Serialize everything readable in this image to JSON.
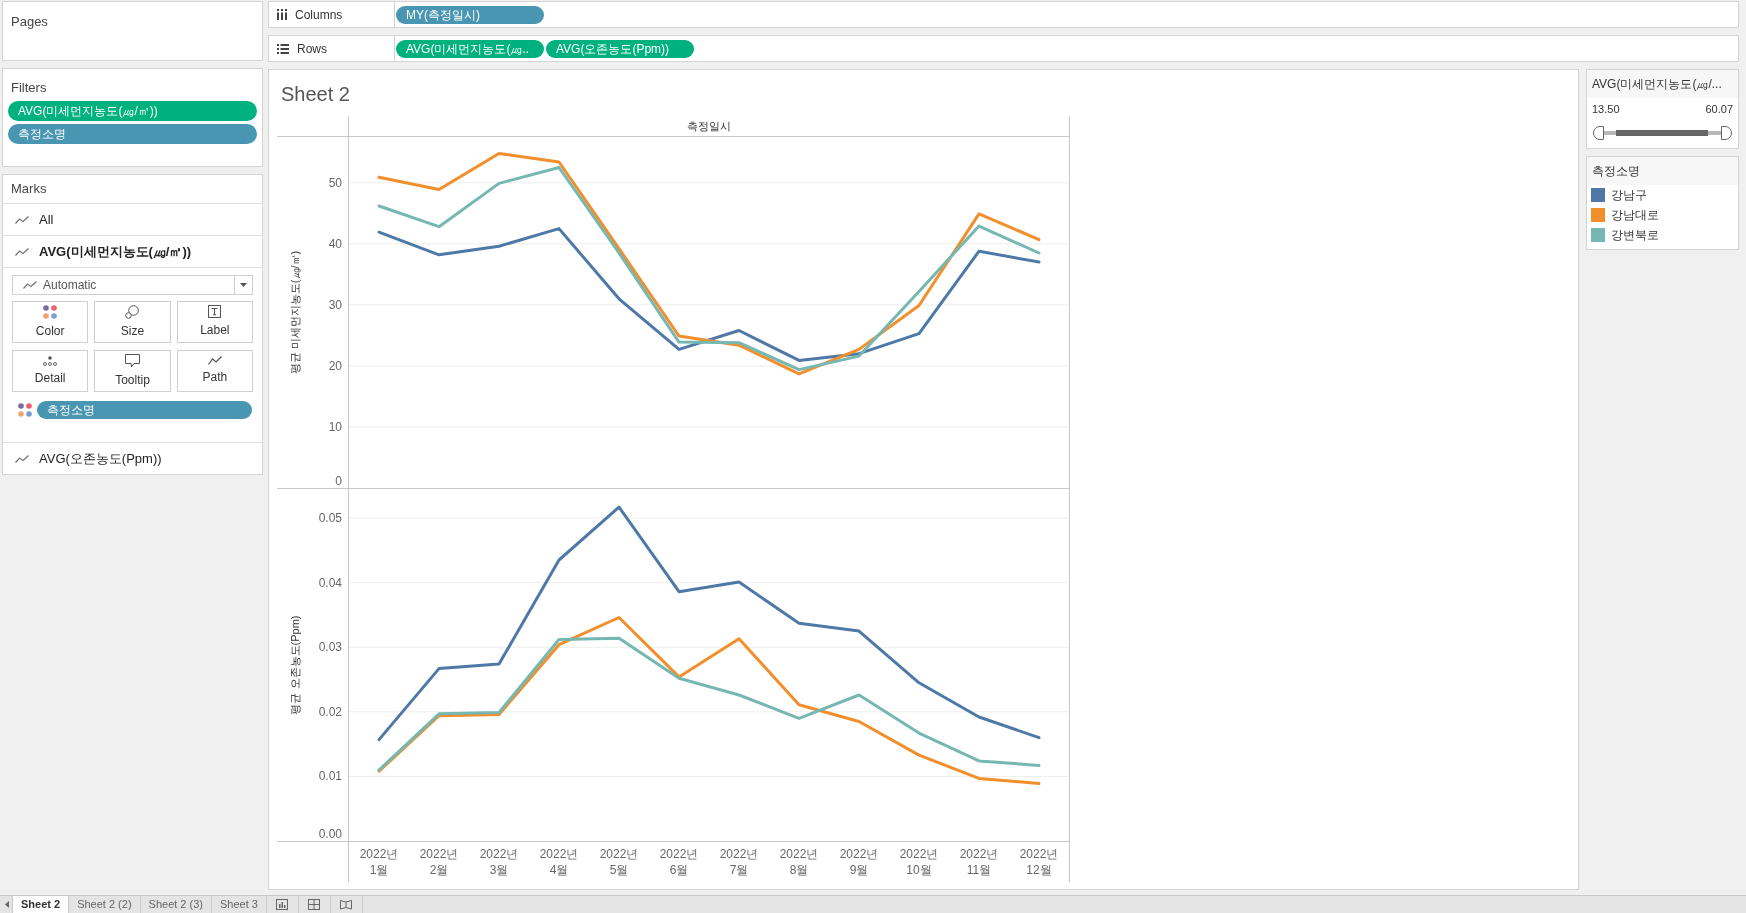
{
  "pages": {
    "title": "Pages"
  },
  "filters": {
    "title": "Filters",
    "pills": [
      {
        "label": "AVG(미세먼지농도(㎍/㎥))",
        "kind": "measure"
      },
      {
        "label": "측정소명",
        "kind": "dimension"
      }
    ]
  },
  "marks": {
    "title": "Marks",
    "cards": [
      {
        "label": "All",
        "expanded": false
      },
      {
        "label": "AVG(미세먼지농도(㎍/㎥))",
        "expanded": true,
        "mark_type": "Automatic",
        "properties": [
          "Color",
          "Size",
          "Label",
          "Detail",
          "Tooltip",
          "Path"
        ],
        "pills": [
          {
            "label": "측정소명",
            "kind": "dimension"
          }
        ]
      },
      {
        "label": "AVG(오존농도(Ppm))",
        "expanded": false
      }
    ]
  },
  "shelves": [
    {
      "label": "Columns",
      "kind": "columns",
      "pills": [
        {
          "label": "MY(측정일시)",
          "kind": "dimension"
        }
      ]
    },
    {
      "label": "Rows",
      "kind": "rows",
      "pills": [
        {
          "label": "AVG(미세먼지농도(㎍..",
          "kind": "measure"
        },
        {
          "label": "AVG(오존농도(Ppm))",
          "kind": "measure"
        }
      ]
    }
  ],
  "sheet": {
    "title": "Sheet 2",
    "column_header": "측정일시",
    "chart_data": [
      {
        "type": "line",
        "ylabel": "평균 미세먼지농도(㎍/㎥)",
        "series": [
          {
            "color": "#4e79a7",
            "values": [
              41.9,
              38.2,
              39.6,
              42.5,
              31.0,
              22.7,
              25.8,
              20.9,
              22.0,
              25.3,
              38.8,
              37.0
            ]
          },
          {
            "color": "#f28e2b",
            "values": [
              50.9,
              48.9,
              54.8,
              53.4,
              39.2,
              24.9,
              23.4,
              18.7,
              22.7,
              29.9,
              44.9,
              40.7
            ]
          },
          {
            "color": "#76b7b2",
            "values": [
              46.2,
              42.8,
              49.9,
              52.5,
              38.5,
              23.9,
              23.8,
              19.4,
              21.6,
              32.2,
              42.9,
              38.5
            ]
          }
        ],
        "ylim": [
          0,
          57.5
        ],
        "yticks": [
          0,
          10,
          20,
          30,
          40,
          50
        ],
        "tick_labels": "y",
        "grid": true
      },
      {
        "type": "line",
        "ylabel": "평균 오존농도(Ppm)",
        "categories": [
          "2022년 1월",
          "2022년 2월",
          "2022년 3월",
          "2022년 4월",
          "2022년 5월",
          "2022년 6월",
          "2022년 7월",
          "2022년 8월",
          "2022년 9월",
          "2022년 10월",
          "2022년 11월",
          "2022년 12월"
        ],
        "series": [
          {
            "color": "#4e79a7",
            "values": [
              0.0157,
              0.0267,
              0.0274,
              0.0435,
              0.0517,
              0.0386,
              0.0401,
              0.0337,
              0.0325,
              0.0245,
              0.0192,
              0.016
            ]
          },
          {
            "color": "#f28e2b",
            "values": [
              0.0108,
              0.0194,
              0.0196,
              0.0304,
              0.0346,
              0.0254,
              0.0313,
              0.0211,
              0.0185,
              0.0133,
              0.0097,
              0.0089
            ]
          },
          {
            "color": "#76b7b2",
            "values": [
              0.011,
              0.0197,
              0.0199,
              0.0312,
              0.0314,
              0.0252,
              0.0226,
              0.019,
              0.0226,
              0.0167,
              0.0124,
              0.0117
            ]
          }
        ],
        "ylim": [
          0,
          0.0545
        ],
        "yticks": [
          {
            "value": 0,
            "label": "0.00"
          },
          {
            "value": 0.01,
            "label": "0.01"
          },
          {
            "value": 0.02,
            "label": "0.02"
          },
          {
            "value": 0.03,
            "label": "0.03"
          },
          {
            "value": 0.04,
            "label": "0.04"
          },
          {
            "value": 0.05,
            "label": "0.05"
          }
        ],
        "grid": true
      }
    ]
  },
  "filter_card": {
    "title": "AVG(미세먼지농도(㎍/...",
    "min_label": "13.50",
    "max_label": "60.07",
    "level": 1
  },
  "legend": {
    "title": "측정소명",
    "items": [
      {
        "label": "강남구",
        "color": "#4e79a7"
      },
      {
        "label": "강남대로",
        "color": "#f28e2b"
      },
      {
        "label": "강변북로",
        "color": "#76b7b2"
      }
    ]
  },
  "sheet_tabs": [
    {
      "label": "Sheet 2",
      "selected": true
    },
    {
      "label": "Sheet 2 (2)",
      "selected": false
    },
    {
      "label": "Sheet 2 (3)",
      "selected": false
    },
    {
      "label": "Sheet 3",
      "selected": false
    }
  ]
}
